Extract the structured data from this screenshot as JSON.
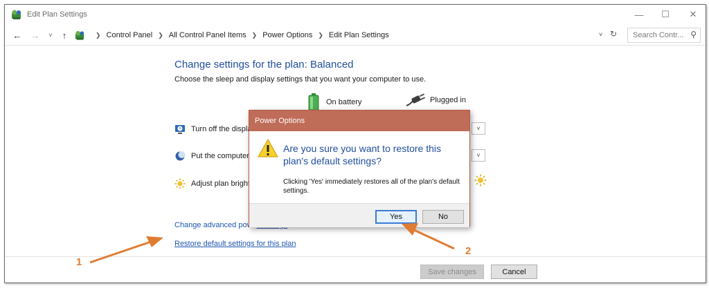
{
  "window": {
    "title": "Edit Plan Settings"
  },
  "addressbar": {
    "crumbs": [
      "Control Panel",
      "All Control Panel Items",
      "Power Options",
      "Edit Plan Settings"
    ],
    "search_placeholder": "Search Contr..."
  },
  "content": {
    "title": "Change settings for the plan: Balanced",
    "subtitle": "Choose the sleep and display settings that you want your computer to use.",
    "col_battery": "On battery",
    "col_plugged": "Plugged in",
    "settings": {
      "display": "Turn off the displa",
      "sleep": "Put the computer",
      "brightness": "Adjust plan bright"
    },
    "link_advanced_pre": "Change advanced powe",
    "link_advanced_post": "r settings",
    "link_restore": "Restore default settings for this plan",
    "save_label": "Save changes",
    "cancel_label": "Cancel"
  },
  "dialog": {
    "title": "Power Options",
    "question": "Are you sure you want to restore this plan's default settings?",
    "message": "Clicking 'Yes' immediately restores all of the plan's default settings.",
    "yes_label": "Yes",
    "no_label": "No"
  },
  "annotations": {
    "marker_1": "1",
    "marker_2": "2"
  },
  "colors": {
    "heading_blue": "#1f4d9b",
    "link_blue": "#1f56b0",
    "dialog_titlebar": "#bf6c58",
    "annotation_orange": "#e07c32"
  },
  "icons": {
    "app": "control-panel-icon",
    "battery": "battery-icon",
    "plug": "power-plug-icon",
    "warning": "warning-icon"
  }
}
